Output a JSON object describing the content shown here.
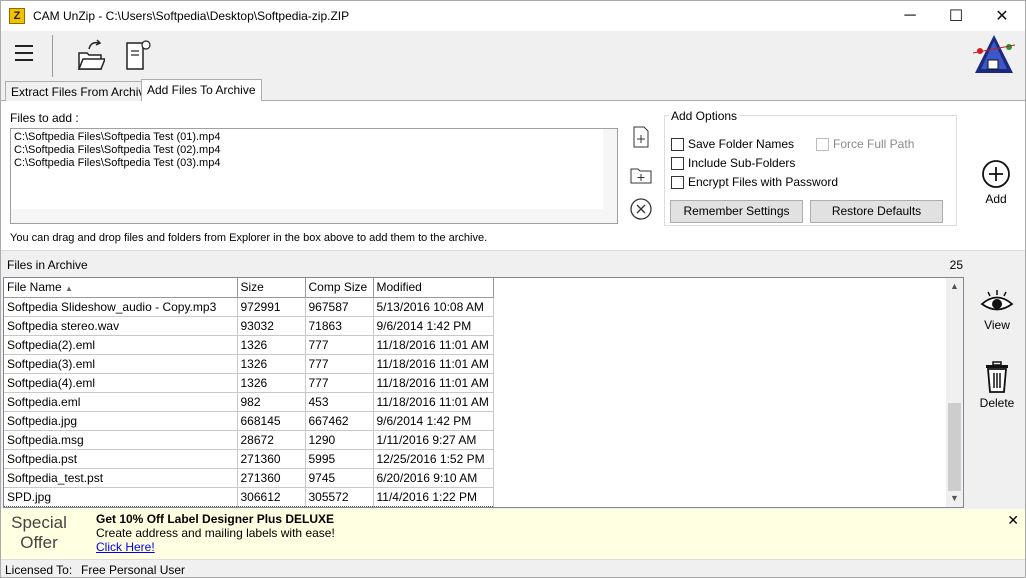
{
  "window": {
    "title": "CAM UnZip - C:\\Users\\Softpedia\\Desktop\\Softpedia-zip.ZIP",
    "minimize": "─",
    "maximize": "☐",
    "close": "✕"
  },
  "tabs": [
    {
      "label": "Extract Files From Archive"
    },
    {
      "label": "Add Files To Archive",
      "active": true
    }
  ],
  "add_panel": {
    "files_label": "Files to add :",
    "files": [
      "C:\\Softpedia Files\\Softpedia Test (01).mp4",
      "C:\\Softpedia Files\\Softpedia Test (02).mp4",
      "C:\\Softpedia Files\\Softpedia Test (03).mp4"
    ],
    "hint": "You can drag and drop files and folders from Explorer in the box above to add them to the archive.",
    "options_title": "Add Options",
    "options": {
      "save_folder_names": "Save Folder Names",
      "force_full_path": "Force Full Path",
      "include_sub_folders": "Include Sub-Folders",
      "encrypt": "Encrypt Files with Password"
    },
    "remember_settings": "Remember Settings",
    "restore_defaults": "Restore Defaults",
    "add_label": "Add"
  },
  "archive": {
    "label": "Files in Archive",
    "count": "25",
    "columns": [
      "File Name",
      "Size",
      "Comp Size",
      "Modified"
    ],
    "sort_indicator": "▲",
    "rows": [
      [
        "Softpedia Slideshow_audio - Copy.mp3",
        "972991",
        "967587",
        "5/13/2016 10:08 AM"
      ],
      [
        "Softpedia stereo.wav",
        "93032",
        "71863",
        "9/6/2014 1:42 PM"
      ],
      [
        "Softpedia(2).eml",
        "1326",
        "777",
        "11/18/2016 11:01 AM"
      ],
      [
        "Softpedia(3).eml",
        "1326",
        "777",
        "11/18/2016 11:01 AM"
      ],
      [
        "Softpedia(4).eml",
        "1326",
        "777",
        "11/18/2016 11:01 AM"
      ],
      [
        "Softpedia.eml",
        "982",
        "453",
        "11/18/2016 11:01 AM"
      ],
      [
        "Softpedia.jpg",
        "668145",
        "667462",
        "9/6/2014 1:42 PM"
      ],
      [
        "Softpedia.msg",
        "28672",
        "1290",
        "1/11/2016 9:27 AM"
      ],
      [
        "Softpedia.pst",
        "271360",
        "5995",
        "12/25/2016 1:52 PM"
      ],
      [
        "Softpedia_test.pst",
        "271360",
        "9745",
        "6/20/2016 9:10 AM"
      ],
      [
        "SPD.jpg",
        "306612",
        "305572",
        "11/4/2016 1:22 PM"
      ]
    ],
    "view_label": "View",
    "delete_label": "Delete"
  },
  "offer": {
    "left_line1": "Special",
    "left_line2": "Offer",
    "title": "Get 10% Off Label Designer Plus DELUXE",
    "desc": "Create address and mailing labels with ease!",
    "link": "Click Here!",
    "close": "✕"
  },
  "status": {
    "key": "Licensed To:",
    "value": "Free Personal User"
  }
}
